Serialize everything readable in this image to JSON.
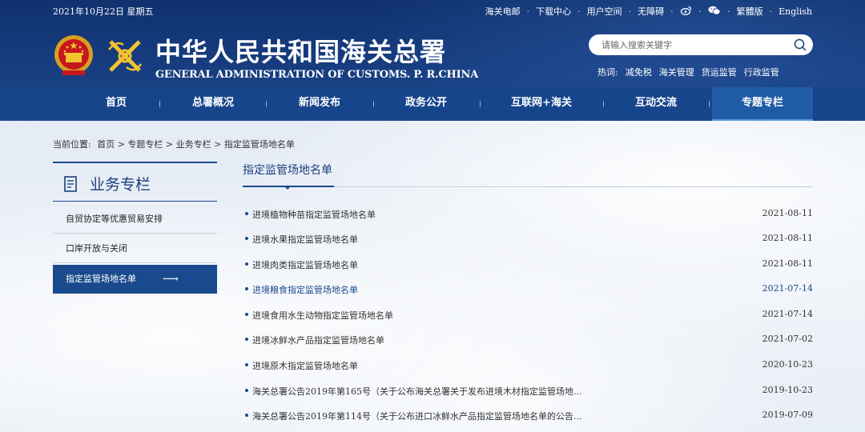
{
  "topbar": {
    "date": "2021年10月22日 星期五",
    "links": [
      "海关电邮",
      "下载中心",
      "用户空间",
      "无障碍"
    ],
    "icons": [
      "weibo-icon",
      "wechat-icon"
    ],
    "traditional": "繁體版",
    "english": "English"
  },
  "header": {
    "title_cn": "中华人民共和国海关总署",
    "title_en": "GENERAL ADMINISTRATION OF CUSTOMS. P. R.CHINA",
    "search_placeholder": "请输入搜索关键字",
    "hotwords_label": "热词:",
    "hotwords": [
      "减免税",
      "海关管理",
      "货运监管",
      "行政监管"
    ]
  },
  "nav": {
    "items": [
      "首页",
      "总署概况",
      "新闻发布",
      "政务公开",
      "互联网+海关",
      "互动交流",
      "专题专栏"
    ],
    "active": "专题专栏"
  },
  "breadcrumb": {
    "label": "当前位置:",
    "path": "首页 > 专题专栏 > 业务专栏 > 指定监管场地名单"
  },
  "sidebar": {
    "title": "业务专栏",
    "items": [
      "自贸协定等优惠贸易安排",
      "口岸开放与关闭",
      "指定监管场地名单"
    ],
    "active_index": 2
  },
  "main": {
    "title": "指定监管场地名单",
    "list": [
      {
        "text": "进境植物种苗指定监管场地名单",
        "date": "2021-08-11"
      },
      {
        "text": "进境水果指定监管场地名单",
        "date": "2021-08-11"
      },
      {
        "text": "进境肉类指定监管场地名单",
        "date": "2021-08-11"
      },
      {
        "text": "进境粮食指定监管场地名单",
        "date": "2021-07-14"
      },
      {
        "text": "进境食用水生动物指定监管场地名单",
        "date": "2021-07-14"
      },
      {
        "text": "进境冰鲜水产品指定监管场地名单",
        "date": "2021-07-02"
      },
      {
        "text": "进境原木指定监管场地名单",
        "date": "2020-10-23"
      },
      {
        "text": "海关总署公告2019年第165号（关于公布海关总署关于发布进境木材指定监管场地...",
        "date": "2019-10-23"
      },
      {
        "text": "海关总署公告2019年第114号（关于公布进口冰鲜水产品指定监管场地名单的公告...",
        "date": "2019-07-09"
      }
    ],
    "highlight_index": 3
  },
  "colors": {
    "header_bg": "#173d80",
    "nav_bg": "#17458c",
    "accent": "#1a4a8e"
  }
}
